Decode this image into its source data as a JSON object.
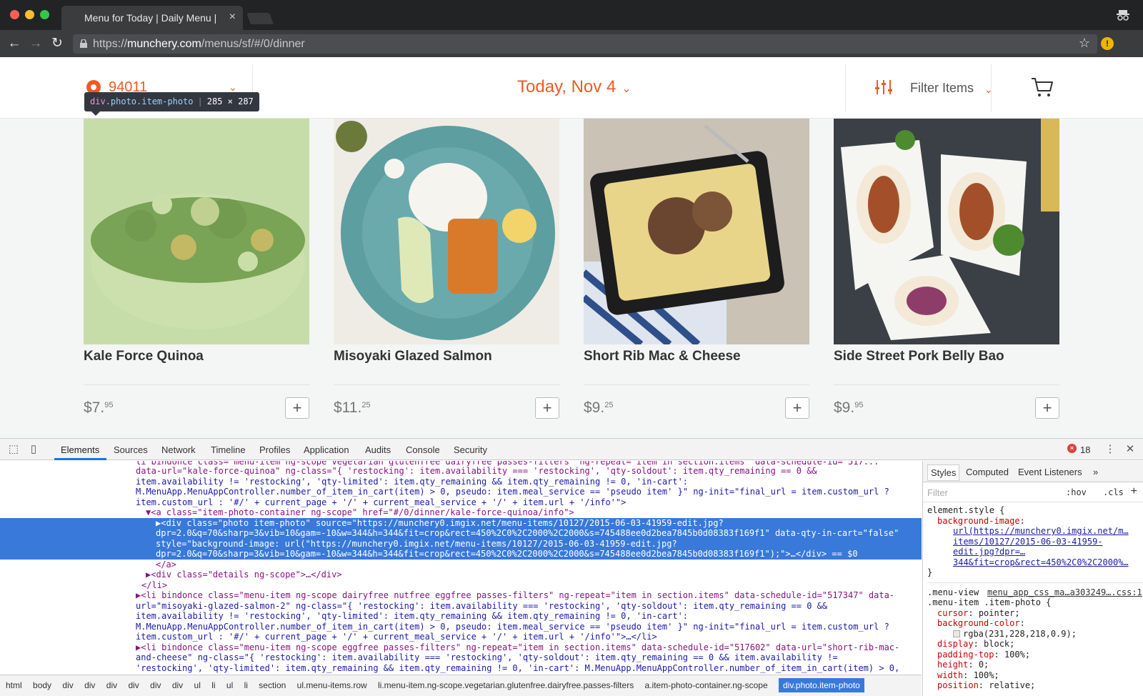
{
  "browser": {
    "tab_title": "Menu for Today | Daily Menu |",
    "tab_close": "×",
    "url_scheme": "https://",
    "url_host": "munchery.com",
    "url_path": "/menus/sf/#/0/dinner"
  },
  "header": {
    "zip": "94011",
    "date": "Today, Nov 4",
    "filter_label": "Filter Items"
  },
  "tooltip": {
    "tag": "div",
    "classes": ".photo.item-photo",
    "size": "285 × 287"
  },
  "items": [
    {
      "name": "Kale Force Quinoa",
      "price_main": "$7.",
      "price_cents": "95",
      "add": "+"
    },
    {
      "name": "Misoyaki Glazed Salmon",
      "price_main": "$11.",
      "price_cents": "25",
      "add": "+"
    },
    {
      "name": "Short Rib Mac & Cheese",
      "price_main": "$9.",
      "price_cents": "25",
      "add": "+"
    },
    {
      "name": "Side Street Pork Belly Bao",
      "price_main": "$9.",
      "price_cents": "95",
      "add": "+"
    }
  ],
  "devtools": {
    "tabs": [
      "Elements",
      "Sources",
      "Network",
      "Timeline",
      "Profiles",
      "Application",
      "Audits",
      "Console",
      "Security"
    ],
    "error_count": "18",
    "dom_lines": [
      "li bindonce class=\"menu-item ng-scope vegetarian glutenfree dairyfree passes-filters\" ng-repeat=\"item in section.items\" data-schedule-id=\"517...",
      "data-url=\"kale-force-quinoa\" ng-class=\"{ 'restocking': item.availability === 'restocking', 'qty-soldout': item.qty_remaining == 0 &&",
      "item.availability != 'restocking', 'qty-limited': item.qty_remaining && item.qty_remaining != 0, 'in-cart':",
      "M.MenuApp.MenuAppController.number_of_item_in_cart(item) > 0, pseudo: item.meal_service == 'pseudo item' }\" ng-init=\"final_url = item.custom_url ?",
      "item.custom_url : '#/' + current_page + '/' + current_meal_service + '/' + item.url + '/info'\">",
      "▼<a class=\"item-photo-container ng-scope\" href=\"#/0/dinner/kale-force-quinoa/info\">",
      "▶<div class=\"photo item-photo\" source=\"https://munchery0.imgix.net/menu-items/10127/2015-06-03-41959-edit.jpg?",
      "dpr=2.0&q=70&sharp=3&vib=10&gam=-10&w=344&h=344&fit=crop&rect=450%2C0%2C2000%2C2000&s=745488ee0d2bea7845b0d08383f169f1\" data-qty-in-cart=\"false\"",
      "style=\"background-image: url(\"https://munchery0.imgix.net/menu-items/10127/2015-06-03-41959-edit.jpg?",
      "dpr=2.0&q=70&sharp=3&vib=10&gam=-10&w=344&h=344&fit=crop&rect=450%2C0%2C2000%2C2000&s=745488ee0d2bea7845b0d08383f169f1\");\">…</div> == $0",
      "</a>",
      "▶<div class=\"details ng-scope\">…</div>",
      "</li>",
      "▶<li bindonce class=\"menu-item ng-scope dairyfree nutfree eggfree passes-filters\" ng-repeat=\"item in section.items\" data-schedule-id=\"517347\" data-",
      "url=\"misoyaki-glazed-salmon-2\" ng-class=\"{ 'restocking': item.availability === 'restocking', 'qty-soldout': item.qty_remaining == 0 &&",
      "item.availability != 'restocking', 'qty-limited': item.qty_remaining && item.qty_remaining != 0, 'in-cart':",
      "M.MenuApp.MenuAppController.number_of_item_in_cart(item) > 0, pseudo: item.meal_service == 'pseudo item' }\" ng-init=\"final_url = item.custom_url ?",
      "item.custom_url : '#/' + current_page + '/' + current_meal_service + '/' + item.url + '/info'\">…</li>",
      "▶<li bindonce class=\"menu-item ng-scope eggfree passes-filters\" ng-repeat=\"item in section.items\" data-schedule-id=\"517602\" data-url=\"short-rib-mac-",
      "and-cheese\" ng-class=\"{ 'restocking': item.availability === 'restocking', 'qty-soldout': item.qty_remaining == 0 && item.availability !=",
      "'restocking', 'qty-limited': item.qty_remaining && item.qty_remaining != 0, 'in-cart': M.MenuApp.MenuAppController.number_of_item_in_cart(item) > 0,"
    ],
    "breadcrumbs": [
      "html",
      "body",
      "div",
      "div",
      "div",
      "div",
      "div",
      "div",
      "ul",
      "li",
      "ul",
      "li",
      "section",
      "ul.menu-items.row",
      "li.menu-item.ng-scope.vegetarian.glutenfree.dairyfree.passes-filters",
      "a.item-photo-container.ng-scope",
      "div.photo.item-photo"
    ],
    "styles": {
      "tabs": [
        "Styles",
        "Computed",
        "Event Listeners",
        "»"
      ],
      "filter_placeholder": "Filter",
      "hov": ":hov",
      "cls": ".cls",
      "plus": "+",
      "element_style": "element.style {",
      "bg_image_prop": "background-image:",
      "bg_url_1": "url(https://munchery0.imgix.net/m…",
      "bg_url_2": "items/10127/2015-06-03-41959-",
      "bg_url_3": "edit.jpg?dpr=…",
      "bg_url_4": "344&fit=crop&rect=450%2C0%2C2000%…",
      "close_brace": "}",
      "rule_selector": ".menu-view",
      "rule_source": "menu_app_css_ma…a303249….css:1",
      "rule_selector_2": ".menu-item .item-photo {",
      "props": [
        {
          "name": "cursor",
          "value": "pointer;"
        },
        {
          "name": "background-color",
          "value": ""
        },
        {
          "name": "",
          "value": "rgba(231,228,218,0.9);"
        },
        {
          "name": "display",
          "value": "block;"
        },
        {
          "name": "padding-top",
          "value": "100%;"
        },
        {
          "name": "height",
          "value": "0;"
        },
        {
          "name": "width",
          "value": "100%;"
        },
        {
          "name": "position",
          "value": "relative;"
        }
      ]
    }
  }
}
